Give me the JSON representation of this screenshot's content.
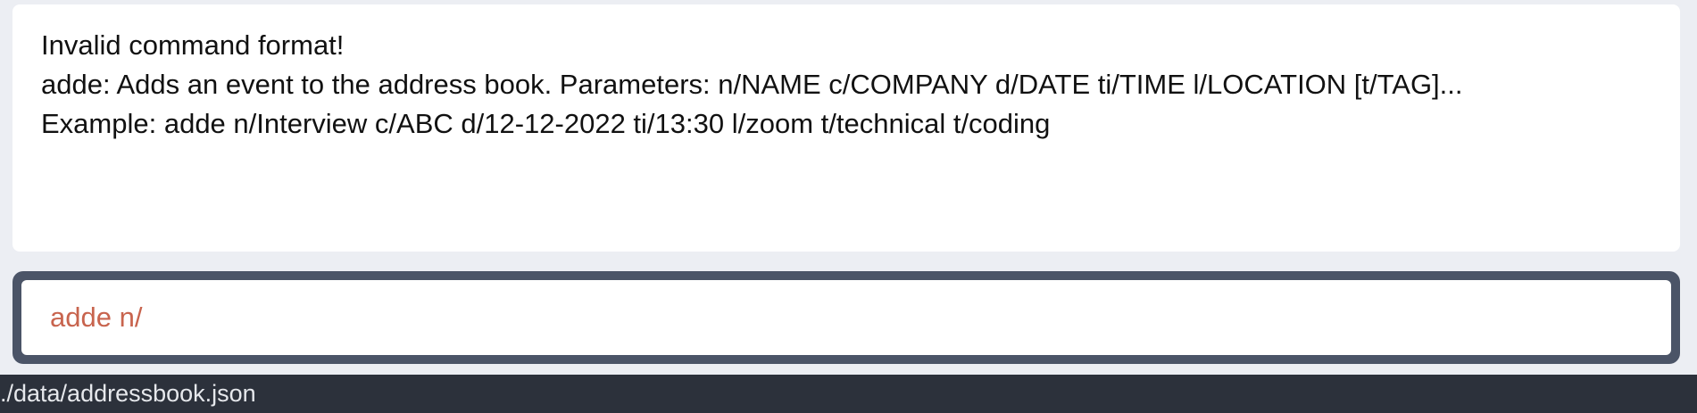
{
  "result_display": {
    "lines": [
      "Invalid command format!",
      "adde: Adds an event to the address book. Parameters: n/NAME c/COMPANY d/DATE ti/TIME l/LOCATION [t/TAG]...",
      "Example: adde n/Interview c/ABC d/12-12-2022 ti/13:30 l/zoom t/technical t/coding"
    ]
  },
  "command_box": {
    "value": "adde n/"
  },
  "status_bar": {
    "file_path": "./data/addressbook.json"
  },
  "colors": {
    "background": "#eceef3",
    "command_border": "#4b5467",
    "error_text": "#c8644e",
    "status_bar": "#2c313b"
  }
}
